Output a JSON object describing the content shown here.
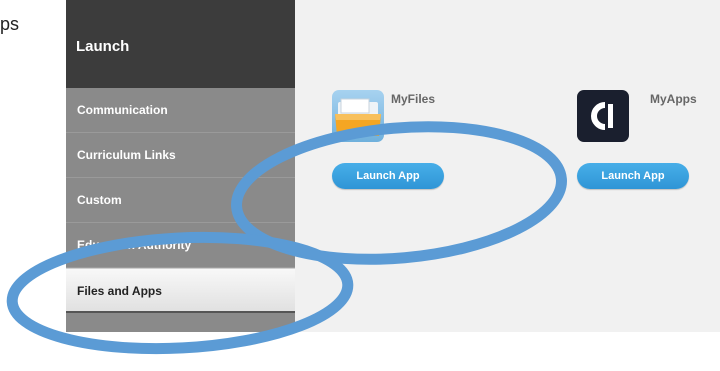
{
  "fragment_text": "ps",
  "sidebar": {
    "title": "Launch",
    "items": [
      {
        "label": "Communication"
      },
      {
        "label": "Curriculum Links"
      },
      {
        "label": "Custom"
      },
      {
        "label": "Education Authority"
      },
      {
        "label": "Files and Apps"
      }
    ],
    "active_index": 4
  },
  "apps": [
    {
      "name": "MyFiles",
      "button": "Launch App",
      "icon": "folder-icon"
    },
    {
      "name": "MyApps",
      "button": "Launch App",
      "icon": "myapps-logo-icon"
    }
  ],
  "colors": {
    "highlight_ring": "#5b9bd5",
    "button": "#2f95d6",
    "sidebar_header": "#3c3c3c",
    "sidebar": "#8a8a8a"
  }
}
